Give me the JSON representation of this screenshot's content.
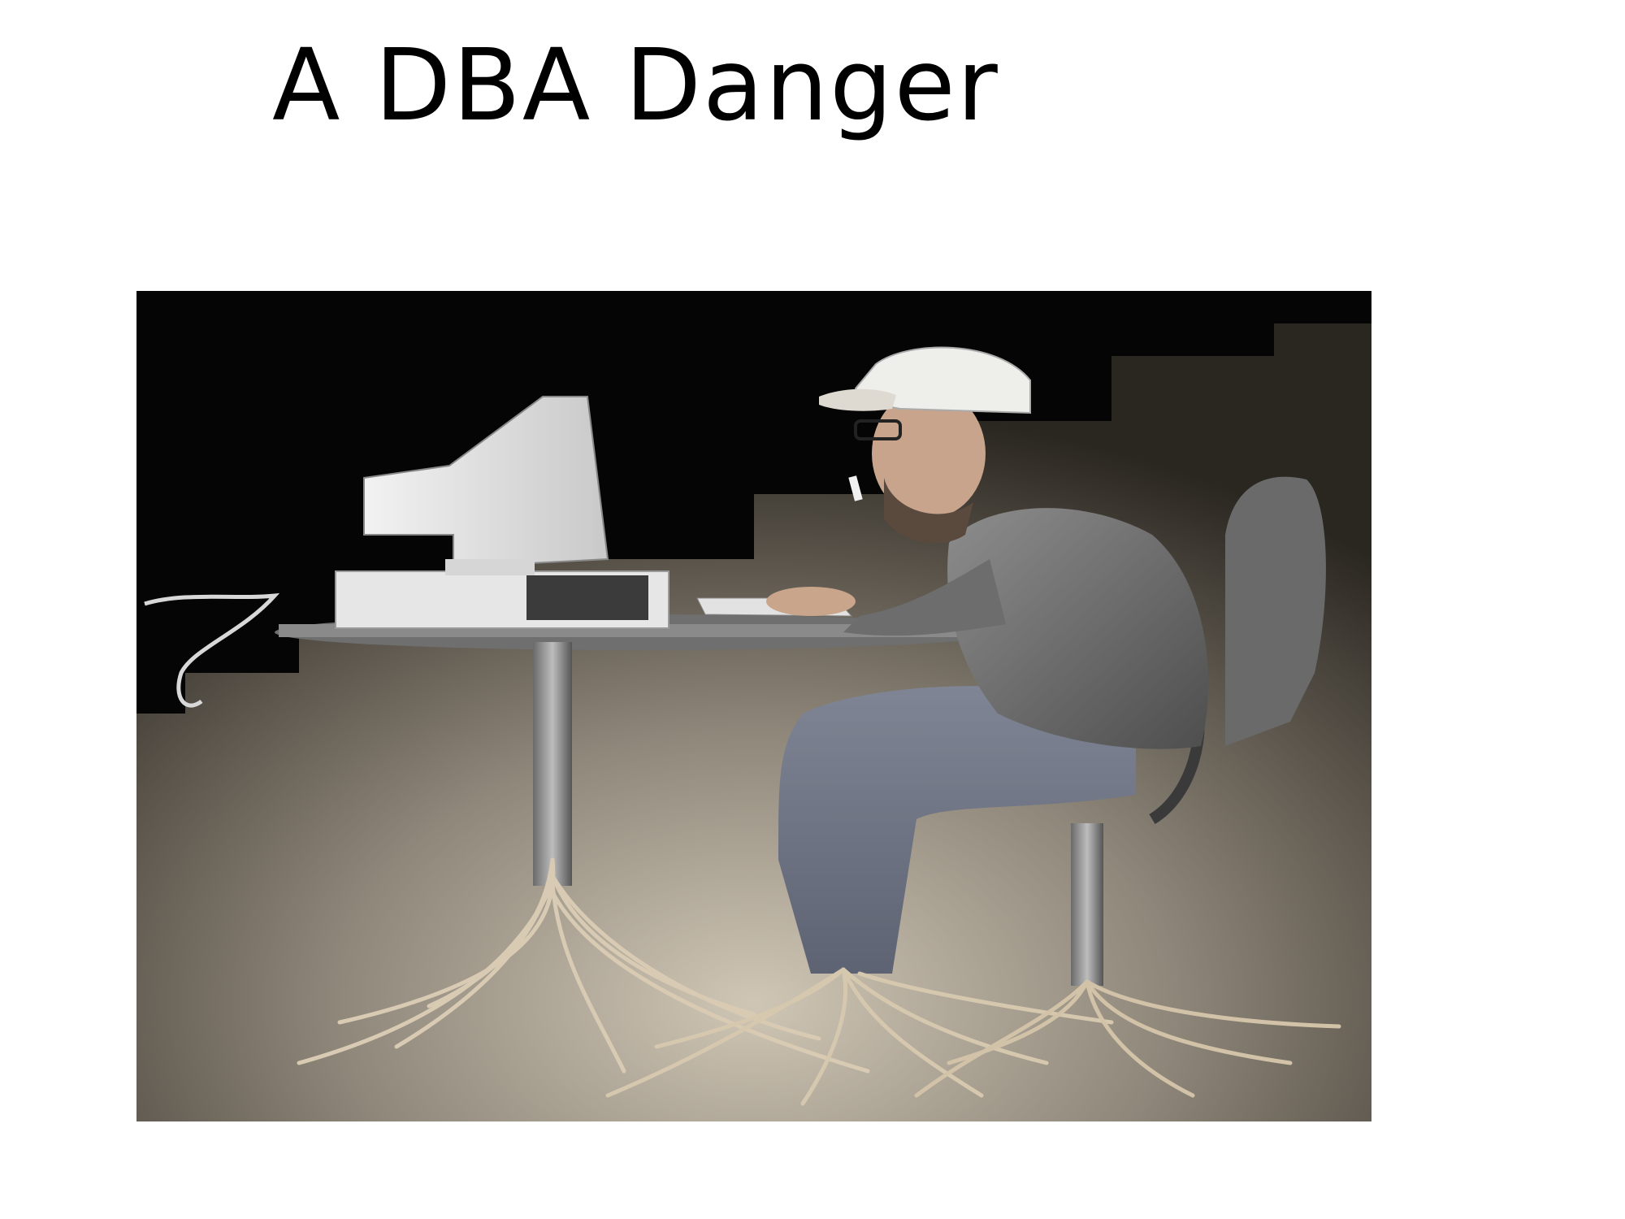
{
  "slide": {
    "title": "A DBA Danger"
  },
  "photo": {
    "subject": "man-at-computer-rooted-to-floor",
    "colors": {
      "backdrop": "#050505",
      "floor_light": "#c9bfae",
      "floor_dark": "#3a342c"
    }
  }
}
